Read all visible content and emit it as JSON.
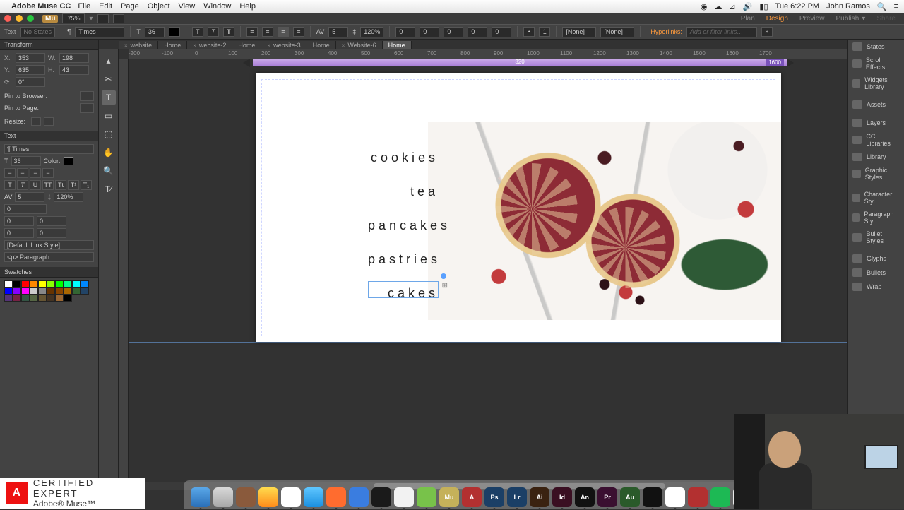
{
  "mac_menu": {
    "app": "Adobe Muse CC",
    "items": [
      "File",
      "Edit",
      "Page",
      "Object",
      "View",
      "Window",
      "Help"
    ],
    "right": {
      "time": "Tue 6:22 PM",
      "user": "John Ramos"
    }
  },
  "app_top": {
    "zoom": "75%"
  },
  "mode_bar": {
    "items": [
      "Plan",
      "Design",
      "Preview",
      "Publish"
    ],
    "active": "Design"
  },
  "control": {
    "label": "Text",
    "states": "No States",
    "font": "Times",
    "size": "36",
    "leading": "120%",
    "tracking": "5",
    "values": {
      "a": "0",
      "b": "0",
      "c": "0",
      "d": "0",
      "e": "0"
    },
    "char_style": "[None]",
    "para_style": "[None]",
    "hyper_label": "Hyperlinks:",
    "hyper_placeholder": "Add or filter links…"
  },
  "doc_tabs": [
    {
      "name": "website",
      "sub": "Home"
    },
    {
      "name": "website-2",
      "sub": "Home"
    },
    {
      "name": "website-3",
      "sub": "Home"
    },
    {
      "name": "Website-6",
      "sub": "Home",
      "active": true
    }
  ],
  "ruler_marks": [
    "-200",
    "-100",
    "0",
    "100",
    "200",
    "300",
    "400",
    "500",
    "600",
    "700",
    "800",
    "900",
    "1000",
    "1100",
    "1200",
    "1300",
    "1400",
    "1500",
    "1600",
    "1700"
  ],
  "breakpoint": {
    "value": "1600",
    "label": "320"
  },
  "transform": {
    "label": "Transform",
    "x": "353",
    "y": "635",
    "w": "198",
    "h": "43",
    "rotate": "0°",
    "pin_browser": "Pin to Browser:",
    "pin_page": "Pin to Page:",
    "resize": "Resize:"
  },
  "text_panel": {
    "label": "Text",
    "font": "Times",
    "size": "36",
    "color_label": "Color:",
    "tracking": "5",
    "leading": "120%",
    "v0": "0",
    "v1": "0",
    "v2": "0",
    "v3": "0",
    "v4": "0",
    "link_style": "[Default Link Style]",
    "tag": "<p> Paragraph"
  },
  "swatches_label": "Swatches",
  "swatch_colors": [
    "#ffffff",
    "#000000",
    "#ff0000",
    "#ff8800",
    "#ffff00",
    "#88ff00",
    "#00ff00",
    "#00ff88",
    "#00ffff",
    "#0088ff",
    "#0000ff",
    "#8800ff",
    "#ff00ff",
    "#cccccc",
    "#888888",
    "#663300",
    "#884400",
    "#aa6600",
    "#336633",
    "#224466",
    "#553377",
    "#772244",
    "#335544",
    "#556644",
    "#665533",
    "#443322",
    "#996633",
    "#000000"
  ],
  "tools": [
    "pointer",
    "crop",
    "text",
    "rect",
    "hand",
    "zoom",
    "type-on-path"
  ],
  "right_panels": [
    "States",
    "Scroll Effects",
    "Widgets Library",
    "Assets",
    "Layers",
    "CC Libraries",
    "Library",
    "Graphic Styles",
    "Character Styl…",
    "Paragraph Styl…",
    "Bullet Styles",
    "Glyphs",
    "Bullets",
    "Wrap"
  ],
  "canvas": {
    "menu_items": [
      "cookies",
      "tea",
      "pancakes",
      "pastries",
      "cakes"
    ]
  },
  "cert": {
    "line1": "CERTIFIED EXPERT",
    "line2": "Adobe® Muse™"
  },
  "dock_apps": [
    {
      "bg": "linear-gradient(#5aa7e8,#2a6fb8)",
      "txt": ""
    },
    {
      "bg": "linear-gradient(#d8d8d8,#a8a8a8)",
      "txt": ""
    },
    {
      "bg": "#8a5a3c",
      "txt": ""
    },
    {
      "bg": "linear-gradient(#ffdb4d,#ff8b1a)",
      "txt": ""
    },
    {
      "bg": "#fff",
      "txt": ""
    },
    {
      "bg": "linear-gradient(#5ec6ff,#1a8fe0)",
      "txt": ""
    },
    {
      "bg": "#ff6c2f",
      "txt": ""
    },
    {
      "bg": "#3a7de0",
      "txt": ""
    },
    {
      "bg": "#1a1a1a",
      "txt": ""
    },
    {
      "bg": "#f2f2f2",
      "txt": ""
    },
    {
      "bg": "#78c24a",
      "txt": ""
    },
    {
      "bg": "#c5b15a",
      "txt": "Mu"
    },
    {
      "bg": "#b33030",
      "txt": "A"
    },
    {
      "bg": "#1b3f66",
      "txt": "Ps"
    },
    {
      "bg": "#1b3f66",
      "txt": "Lr"
    },
    {
      "bg": "#3a2210",
      "txt": "Ai"
    },
    {
      "bg": "#3a0f22",
      "txt": "Id"
    },
    {
      "bg": "#111",
      "txt": "An"
    },
    {
      "bg": "#3a0f30",
      "txt": "Pr"
    },
    {
      "bg": "#2a5a2a",
      "txt": "Au"
    },
    {
      "bg": "#111",
      "txt": ""
    },
    {
      "bg": "#fff",
      "txt": ""
    },
    {
      "bg": "#b33030",
      "txt": ""
    },
    {
      "bg": "#1db954",
      "txt": ""
    },
    {
      "bg": "#e8e8e8",
      "txt": ""
    }
  ]
}
